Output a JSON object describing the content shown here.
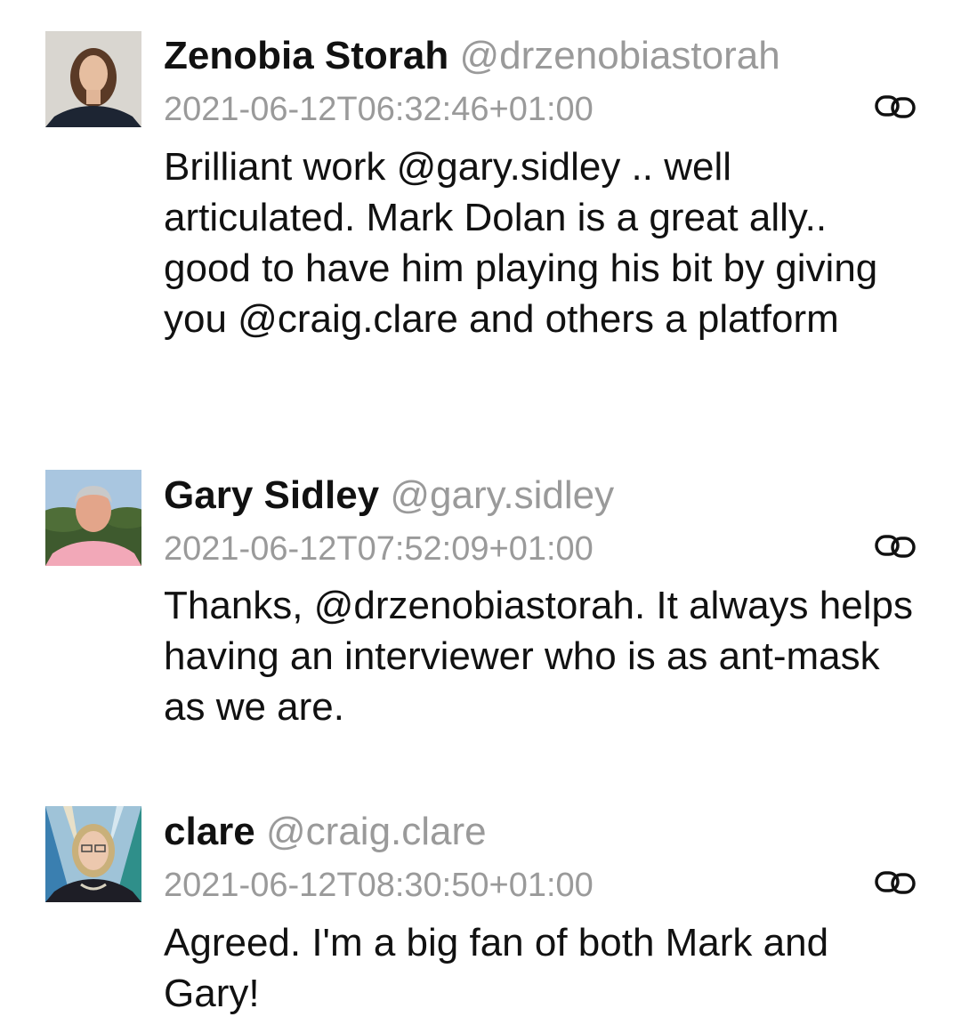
{
  "posts": [
    {
      "display_name": "Zenobia Storah",
      "handle": "@drzenobiastorah",
      "timestamp": "2021-06-12T06:32:46+01:00",
      "text": "Brilliant work @gary.sidley .. well articulated. Mark Dolan is a great ally.. good to have him playing his bit by giving you @craig.clare and others a platform",
      "icon": "link-icon"
    },
    {
      "display_name": "Gary Sidley",
      "handle": "@gary.sidley",
      "timestamp": "2021-06-12T07:52:09+01:00",
      "text": "Thanks, @drzenobiastorah. It always helps having an interviewer who is as ant-mask as we are.",
      "icon": "link-icon"
    },
    {
      "display_name": "clare",
      "handle": "@craig.clare",
      "timestamp": "2021-06-12T08:30:50+01:00",
      "text": "Agreed. I'm a big fan of both Mark and Gary!",
      "icon": "link-icon"
    }
  ],
  "colors": {
    "text": "#111111",
    "muted": "#9a9a9a",
    "background": "#ffffff"
  }
}
